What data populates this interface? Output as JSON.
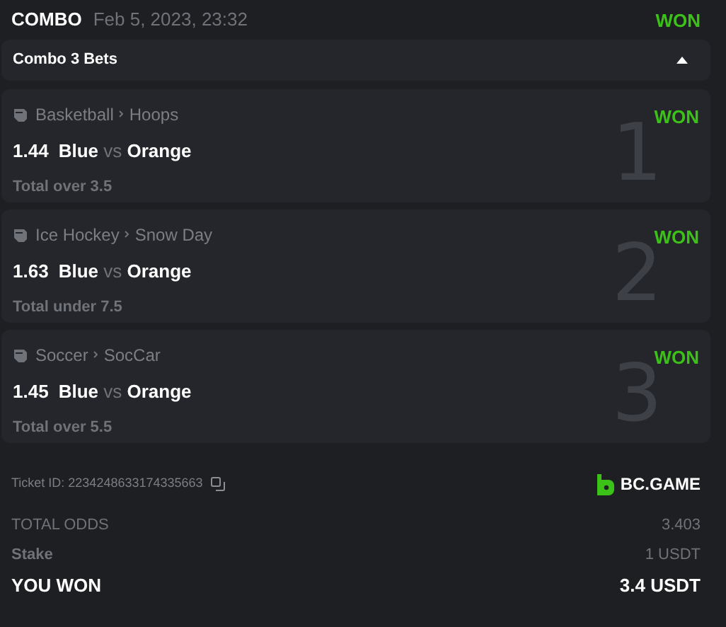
{
  "header": {
    "type": "COMBO",
    "date": "Feb 5, 2023, 23:32",
    "status": "WON"
  },
  "group": {
    "title": "Combo 3 Bets",
    "expanded": true
  },
  "bets": [
    {
      "sport": "Basketball",
      "league": "Hoops",
      "status": "WON",
      "odds": "1.44",
      "home": "Blue",
      "vs": "vs",
      "away": "Orange",
      "selection": "Total over 3.5",
      "number": "1"
    },
    {
      "sport": "Ice Hockey",
      "league": "Snow Day",
      "status": "WON",
      "odds": "1.63",
      "home": "Blue",
      "vs": "vs",
      "away": "Orange",
      "selection": "Total under 7.5",
      "number": "2"
    },
    {
      "sport": "Soccer",
      "league": "SocCar",
      "status": "WON",
      "odds": "1.45",
      "home": "Blue",
      "vs": "vs",
      "away": "Orange",
      "selection": "Total over 5.5",
      "number": "3"
    }
  ],
  "ticket": {
    "label": "Ticket ID: 2234248633174335663",
    "brand": "BC.GAME"
  },
  "totals": [
    {
      "label": "TOTAL ODDS",
      "value": "3.403",
      "kind": "plain"
    },
    {
      "label": "Stake",
      "value": "1 USDT",
      "kind": "semibold"
    },
    {
      "label": "YOU WON",
      "value": "3.4 USDT",
      "kind": "result"
    }
  ]
}
